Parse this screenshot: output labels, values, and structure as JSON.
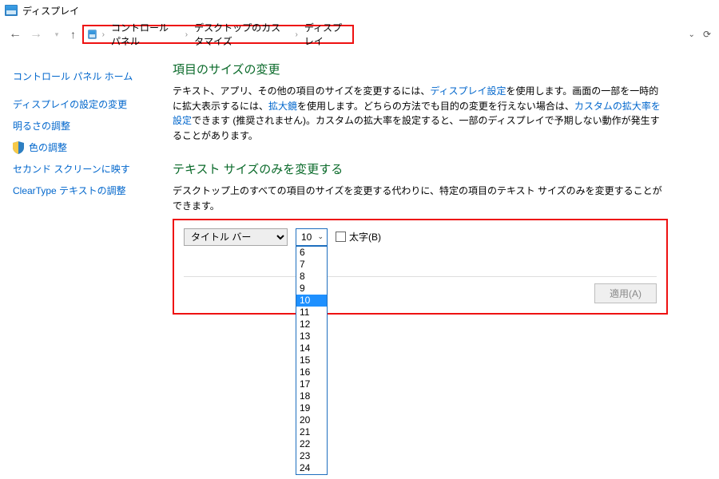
{
  "window": {
    "title": "ディスプレイ"
  },
  "breadcrumb": {
    "items": [
      "コントロール パネル",
      "デスクトップのカスタマイズ",
      "ディスプレイ"
    ]
  },
  "sidebar": {
    "items": [
      {
        "label": "コントロール パネル ホーム",
        "shield": false
      },
      {
        "label": "ディスプレイの設定の変更",
        "shield": false
      },
      {
        "label": "明るさの調整",
        "shield": false
      },
      {
        "label": "色の調整",
        "shield": true
      },
      {
        "label": "セカンド スクリーンに映す",
        "shield": false
      },
      {
        "label": "ClearType テキストの調整",
        "shield": false
      }
    ]
  },
  "main": {
    "section1_title": "項目のサイズの変更",
    "section1_text_a": "テキスト、アプリ、その他の項目のサイズを変更するには、",
    "section1_link_a": "ディスプレイ設定",
    "section1_text_b": "を使用します。画面の一部を一時的に拡大表示するには、",
    "section1_link_b": "拡大鏡",
    "section1_text_c": "を使用します。どちらの方法でも目的の変更を行えない場合は、",
    "section1_link_c": "カスタムの拡大率を設定",
    "section1_text_d": "できます (推奨されません)。カスタムの拡大率を設定すると、一部のディスプレイで予期しない動作が発生することがあります。",
    "section2_title": "テキスト サイズのみを変更する",
    "section2_text": "デスクトップ上のすべての項目のサイズを変更する代わりに、特定の項目のテキスト サイズのみを変更することができます。"
  },
  "controls": {
    "item_select_value": "タイトル バー",
    "size_value": "10",
    "size_options": [
      "6",
      "7",
      "8",
      "9",
      "10",
      "11",
      "12",
      "13",
      "14",
      "15",
      "16",
      "17",
      "18",
      "19",
      "20",
      "21",
      "22",
      "23",
      "24"
    ],
    "bold_label": "太字(B)",
    "apply_label": "適用(A)"
  }
}
